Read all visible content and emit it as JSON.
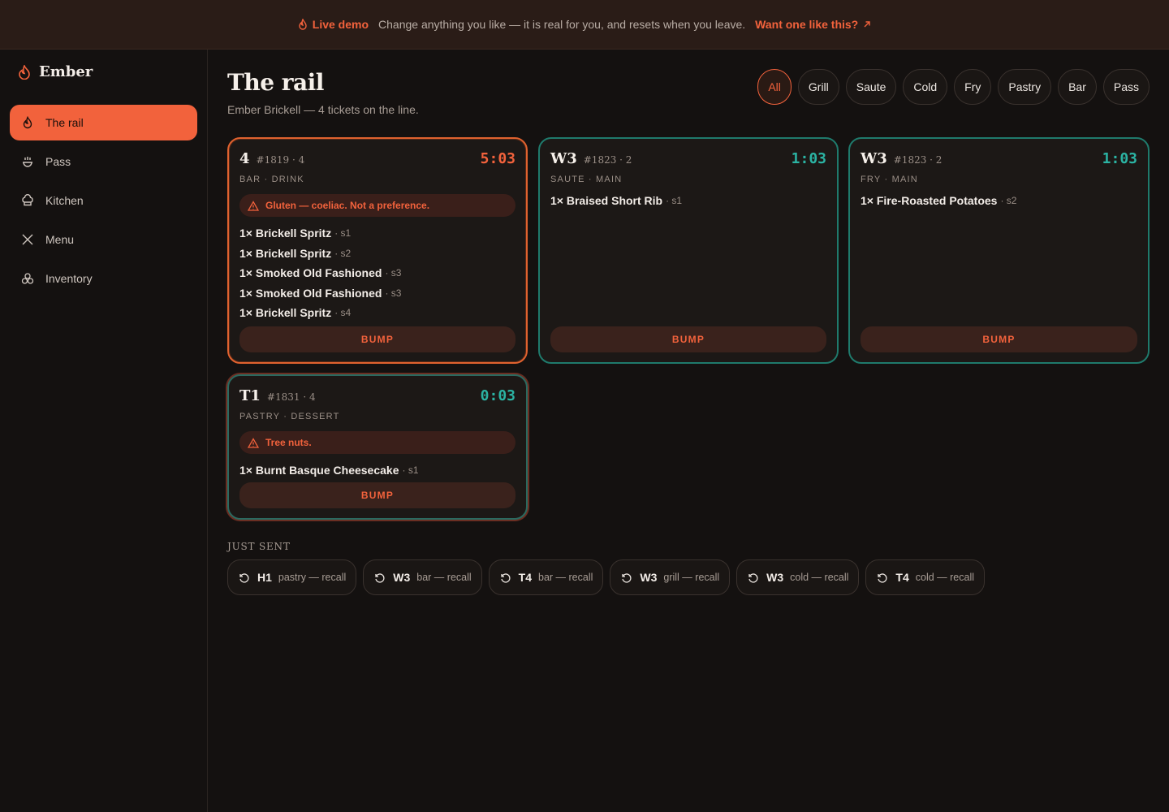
{
  "banner": {
    "live_label": "Live demo",
    "message": "Change anything you like — it is real for you, and resets when you leave.",
    "cta_label": "Want one like this?"
  },
  "sidebar": {
    "brand": "Ember",
    "items": [
      {
        "label": "The rail",
        "icon": "flame-icon",
        "active": true
      },
      {
        "label": "Pass",
        "icon": "hand-plate-icon",
        "active": false
      },
      {
        "label": "Kitchen",
        "icon": "chef-hat-icon",
        "active": false
      },
      {
        "label": "Menu",
        "icon": "utensils-icon",
        "active": false
      },
      {
        "label": "Inventory",
        "icon": "boxes-icon",
        "active": false
      }
    ]
  },
  "page": {
    "title": "The rail",
    "subtitle": "Ember Brickell — 4 tickets on the line."
  },
  "filters": [
    "All",
    "Grill",
    "Saute",
    "Cold",
    "Fry",
    "Pastry",
    "Bar",
    "Pass"
  ],
  "filter_active": "All",
  "tickets": [
    {
      "table": "4",
      "number": "#1819 · 4",
      "timer": "5:03",
      "late": true,
      "meta": "BAR · DRINK",
      "alert": "Gluten — coeliac. Not a preference.",
      "items": [
        {
          "name": "1× Brickell Spritz",
          "seat": "· s1"
        },
        {
          "name": "1× Brickell Spritz",
          "seat": "· s2"
        },
        {
          "name": "1× Smoked Old Fashioned",
          "seat": "· s3"
        },
        {
          "name": "1× Smoked Old Fashioned",
          "seat": "· s3"
        },
        {
          "name": "1× Brickell Spritz",
          "seat": "· s4"
        }
      ],
      "bump": "BUMP"
    },
    {
      "table": "W3",
      "number": "#1823 · 2",
      "timer": "1:03",
      "late": false,
      "meta": "SAUTE · MAIN",
      "items": [
        {
          "name": "1× Braised Short Rib",
          "seat": "· s1"
        }
      ],
      "bump": "BUMP"
    },
    {
      "table": "W3",
      "number": "#1823 · 2",
      "timer": "1:03",
      "late": false,
      "meta": "FRY · MAIN",
      "items": [
        {
          "name": "1× Fire-Roasted Potatoes",
          "seat": "· s2"
        }
      ],
      "bump": "BUMP"
    },
    {
      "table": "T1",
      "number": "#1831 · 4",
      "timer": "0:03",
      "late": false,
      "meta": "PASTRY · DESSERT",
      "alert": "Tree nuts.",
      "items": [
        {
          "name": "1× Burnt Basque Cheesecake",
          "seat": "· s1"
        }
      ],
      "bump": "BUMP"
    }
  ],
  "just_sent": {
    "label": "JUST SENT",
    "items": [
      {
        "table": "H1",
        "action": "pastry — recall"
      },
      {
        "table": "W3",
        "action": "bar — recall"
      },
      {
        "table": "T4",
        "action": "bar — recall"
      },
      {
        "table": "W3",
        "action": "grill — recall"
      },
      {
        "table": "W3",
        "action": "cold — recall"
      },
      {
        "table": "T4",
        "action": "cold — recall"
      }
    ]
  },
  "colors": {
    "accent": "#f2623c",
    "teal": "#2bb3a3",
    "background": "#141110"
  }
}
